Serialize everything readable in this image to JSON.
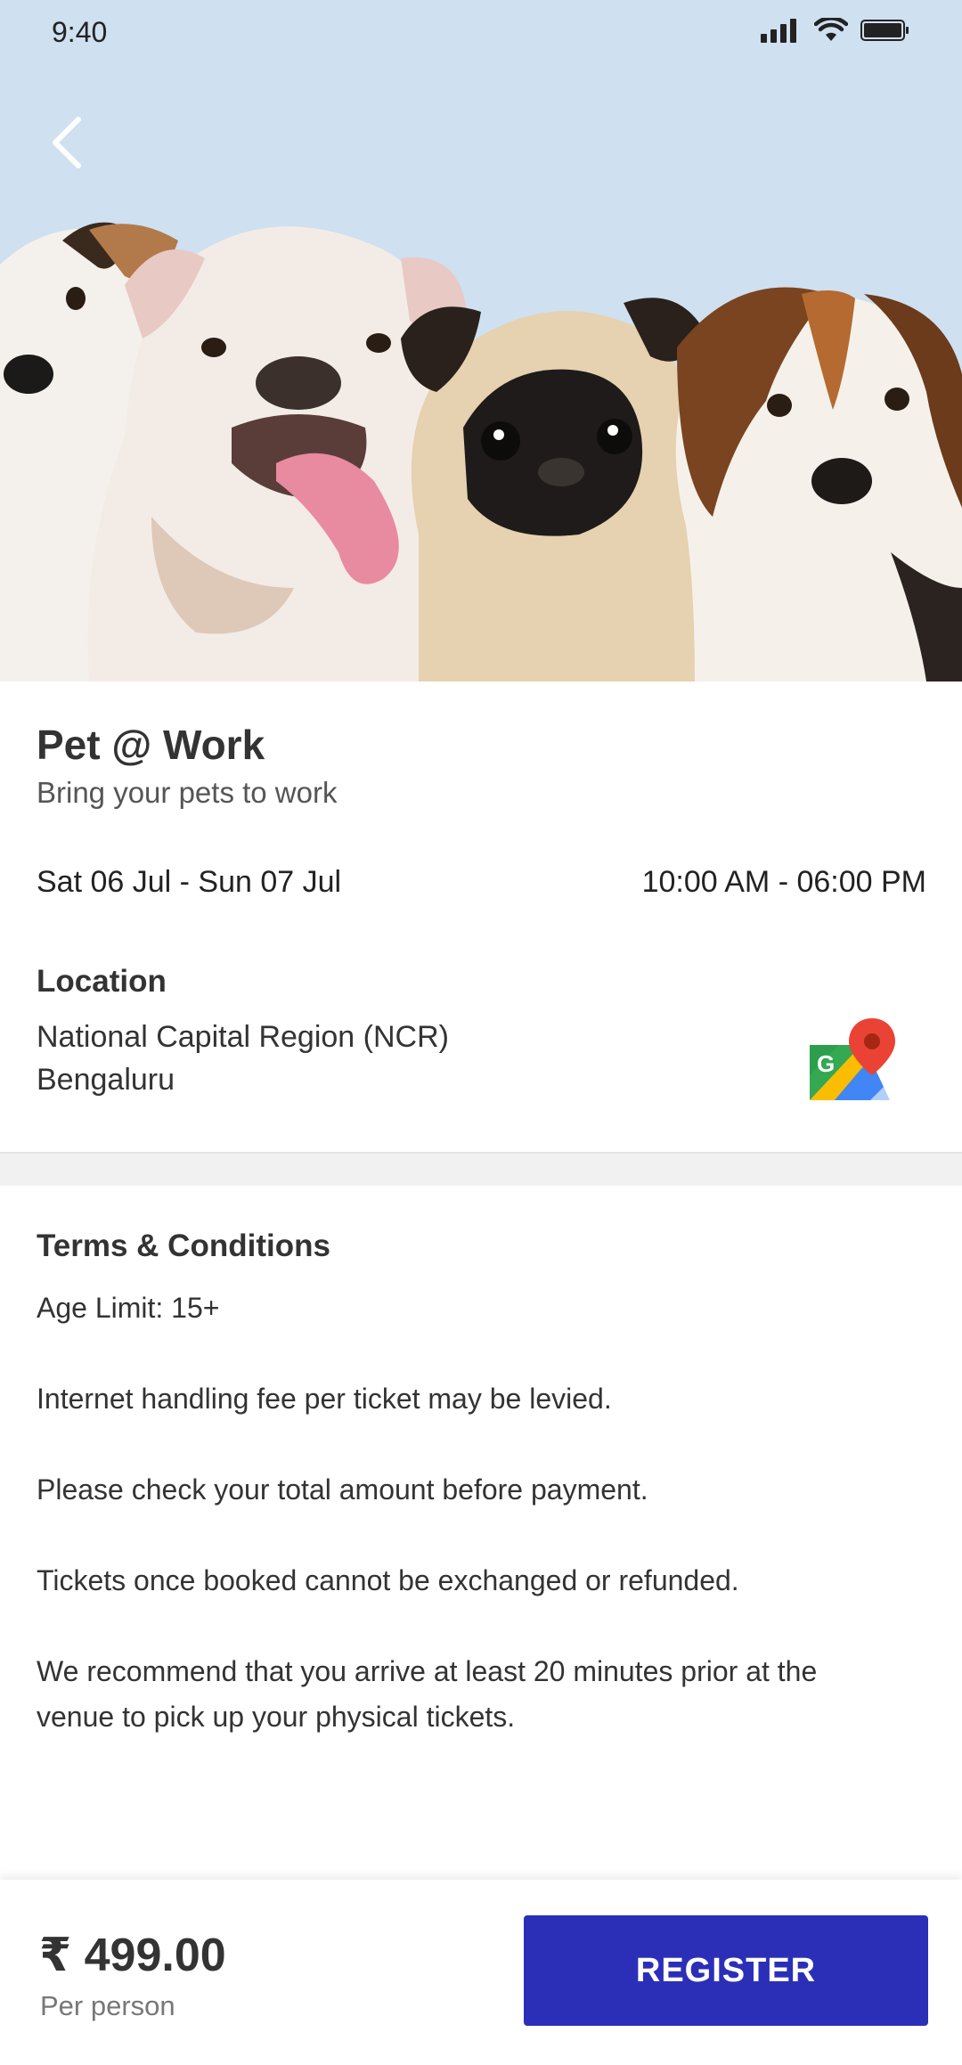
{
  "status_bar": {
    "time": "9:40"
  },
  "event": {
    "title": "Pet @ Work",
    "subtitle": "Bring your pets to work",
    "date_range": "Sat 06 Jul - Sun 07 Jul",
    "time_range": "10:00 AM - 06:00 PM"
  },
  "location": {
    "label": "Location",
    "line1": "National Capital Region (NCR)",
    "line2": "Bengaluru",
    "map_icon": "google-maps-icon"
  },
  "terms": {
    "title": "Terms & Conditions",
    "items": [
      "Age Limit: 15+",
      "Internet handling fee per ticket may be levied.",
      "Please check your total amount before payment.",
      "Tickets once booked cannot be exchanged or refunded.",
      "We recommend that you arrive at least 20 minutes prior at the venue to pick up your physical tickets."
    ]
  },
  "footer": {
    "price": "₹ 499.00",
    "price_note": "Per person",
    "register_label": "REGISTER"
  },
  "colors": {
    "hero_bg": "#cfe0f0",
    "primary_button": "#2b2fb8"
  }
}
